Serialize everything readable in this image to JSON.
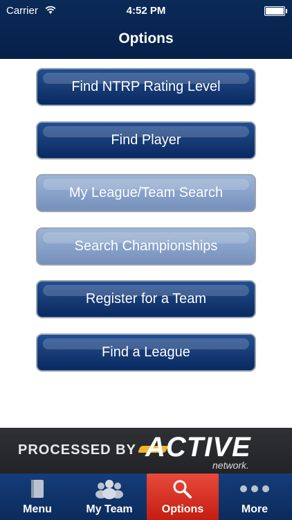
{
  "status_bar": {
    "carrier": "Carrier",
    "time": "4:52 PM"
  },
  "header": {
    "title": "Options"
  },
  "buttons": [
    {
      "label": "Find NTRP Rating Level",
      "style": "dark"
    },
    {
      "label": "Find Player",
      "style": "dark"
    },
    {
      "label": "My League/Team Search",
      "style": "light"
    },
    {
      "label": "Search Championships",
      "style": "light"
    },
    {
      "label": "Register for a Team",
      "style": "dark"
    },
    {
      "label": "Find a League",
      "style": "dark"
    }
  ],
  "banner": {
    "processed": "PROCESSED BY",
    "active": "ACTIVE",
    "network": "network."
  },
  "tabs": [
    {
      "label": "Menu",
      "icon": "book-icon",
      "selected": false
    },
    {
      "label": "My Team",
      "icon": "team-icon",
      "selected": false
    },
    {
      "label": "Options",
      "icon": "search-icon",
      "selected": true
    },
    {
      "label": "More",
      "icon": "more-dots-icon",
      "selected": false
    }
  ],
  "colors": {
    "nav": "#0b2a57",
    "dark_button": "#1b3f7a",
    "light_button": "#86a0c8",
    "selected_tab": "#d93325"
  }
}
